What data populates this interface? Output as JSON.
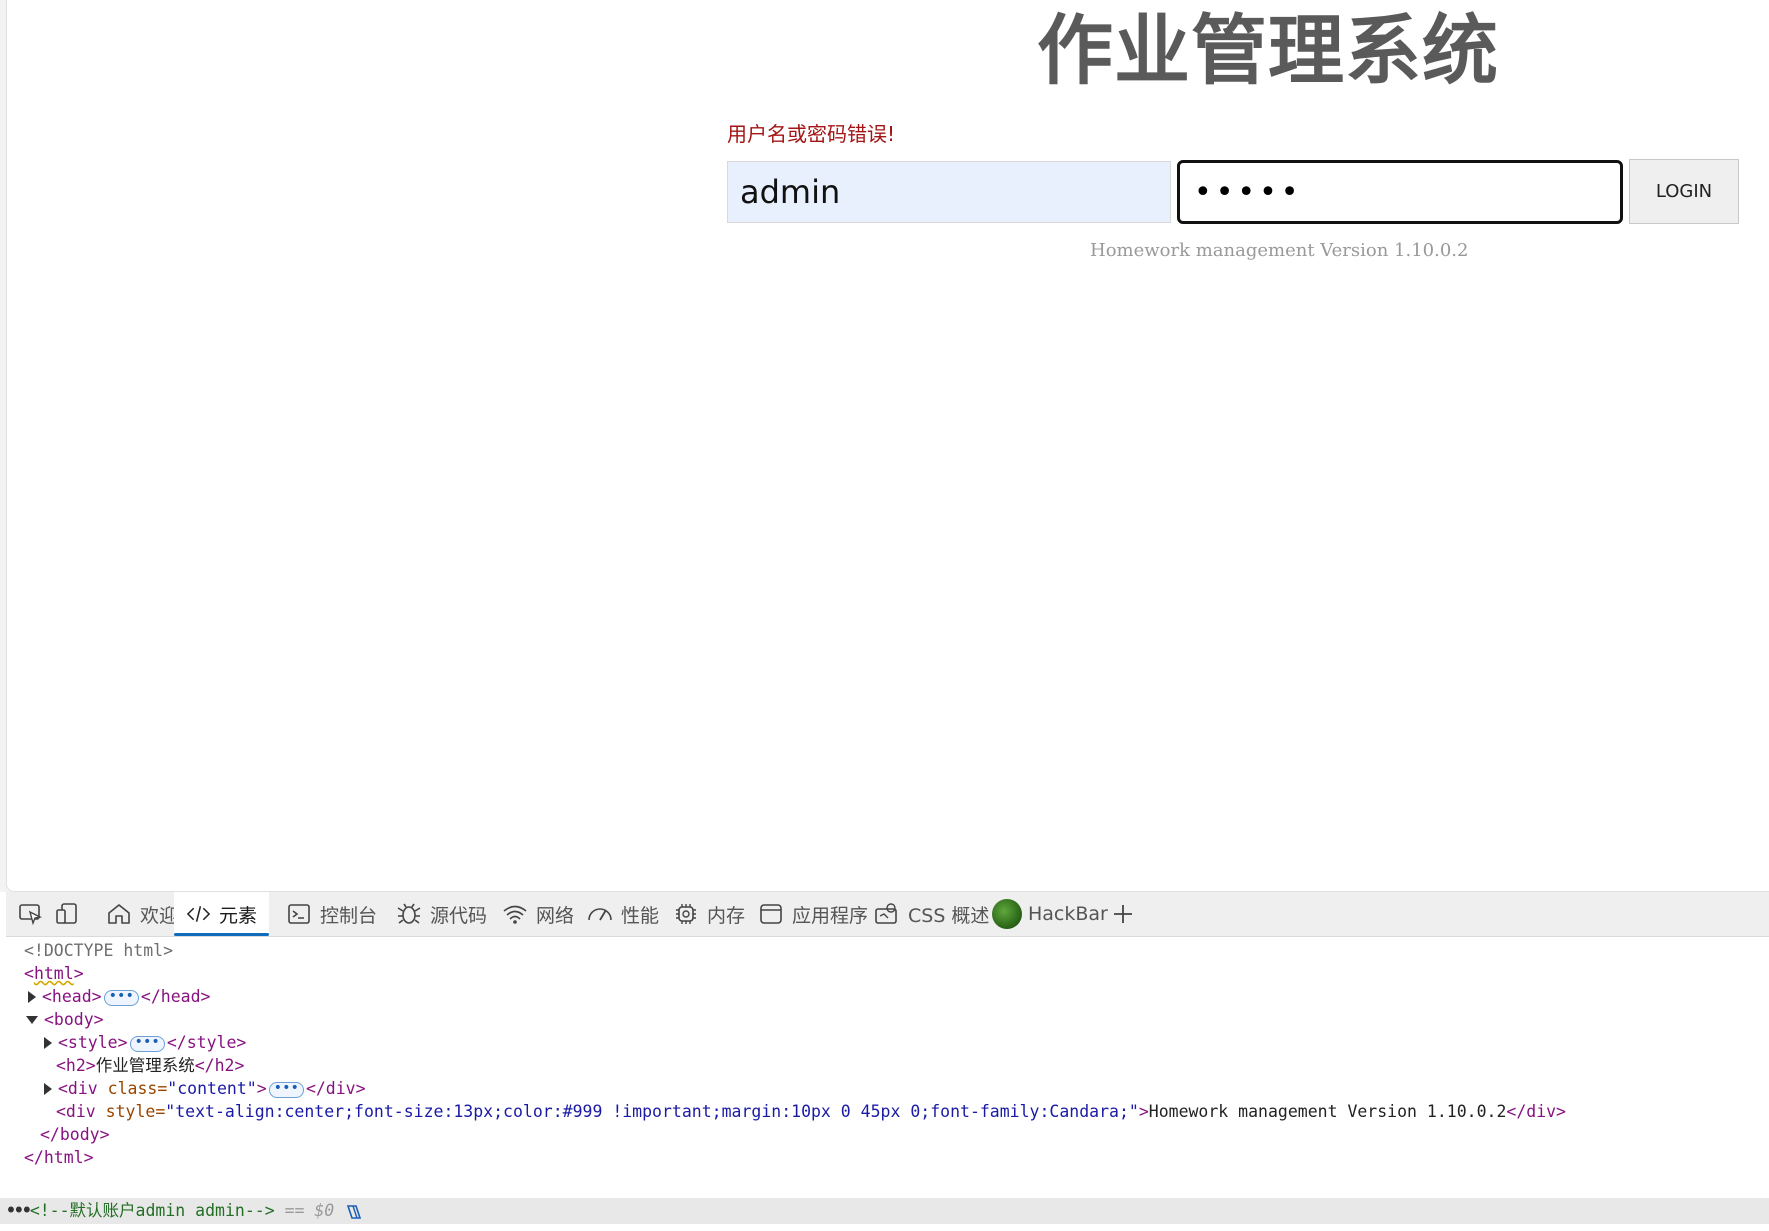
{
  "page": {
    "title": "作业管理系统",
    "error_message": "用户名或密码错误!",
    "username_value": "admin",
    "password_value": "•••••",
    "login_label": "LOGIN",
    "version_text": "Homework management Version 1.10.0.2"
  },
  "devtools": {
    "tabs": [
      {
        "label": "欢迎",
        "icon": "home-icon"
      },
      {
        "label": "元素",
        "icon": "code-icon"
      },
      {
        "label": "控制台",
        "icon": "console-icon"
      },
      {
        "label": "源代码",
        "icon": "bug-icon"
      },
      {
        "label": "网络",
        "icon": "wifi-icon"
      },
      {
        "label": "性能",
        "icon": "gauge-icon"
      },
      {
        "label": "内存",
        "icon": "chip-icon"
      },
      {
        "label": "应用程序",
        "icon": "window-icon"
      },
      {
        "label": "CSS 概述",
        "icon": "css-icon"
      },
      {
        "label": "HackBar",
        "icon": "hackbar-logo-icon"
      }
    ],
    "active_tab": "元素",
    "dom": {
      "doctype": "<!DOCTYPE html>",
      "html_open_a": "<",
      "html_name": "html",
      "html_open_b": ">",
      "head_open": "<head>",
      "head_close": "</head>",
      "body_open": "<body>",
      "style_open": "<style>",
      "style_close": "</style>",
      "h2_open": "<h2>",
      "h2_text": "作业管理系统",
      "h2_close": "</h2>",
      "div_open": "<div",
      "class_attr": " class=",
      "class_val": "\"content\"",
      "gt": ">",
      "div_close": "</div>",
      "style_attr": " style=",
      "style_val": "\"text-align:center;font-size:13px;color:#999 !important;margin:10px 0 45px 0;font-family:Candara;\"",
      "version_text": "Homework management Version 1.10.0.2",
      "body_close": "</body>",
      "html_close": "</html>",
      "comment": "<!--默认账户admin admin-->",
      "selected_marker": "== $0",
      "ellipsis": "•••"
    }
  }
}
